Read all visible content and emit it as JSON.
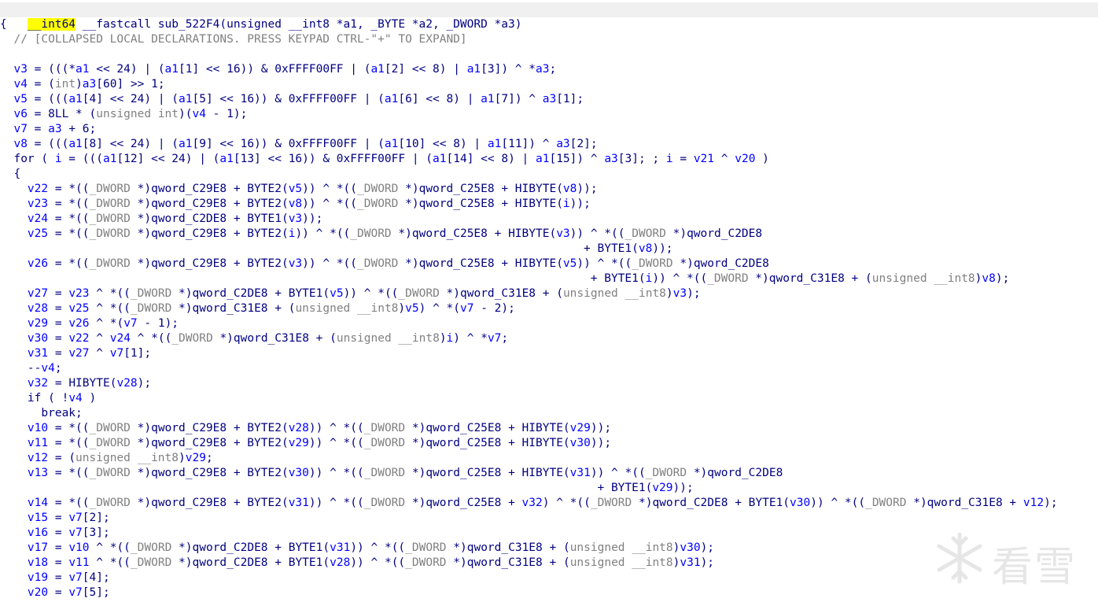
{
  "header": {
    "return_type": "__int64",
    "rest": " __fastcall sub_522F4(unsigned __int8 *a1, _BYTE *a2, _DWORD *a3)"
  },
  "watermark": {
    "text": "看雪",
    "icon": "snowflake-icon"
  },
  "lines": [
    [
      [
        "t",
        "{"
      ]
    ],
    [
      [
        "t",
        "  "
      ],
      [
        "c",
        "// [COLLAPSED LOCAL DECLARATIONS. PRESS KEYPAD CTRL-\"+\" TO EXPAND]"
      ]
    ],
    [],
    [
      [
        "t",
        "  "
      ],
      [
        "v",
        "v3"
      ],
      [
        "t",
        " = (((*"
      ],
      [
        "v",
        "a1"
      ],
      [
        "t",
        " << 24) | ("
      ],
      [
        "v",
        "a1"
      ],
      [
        "t",
        "[1] << 16)) & 0xFFFF00FF | ("
      ],
      [
        "v",
        "a1"
      ],
      [
        "t",
        "[2] << 8) | "
      ],
      [
        "v",
        "a1"
      ],
      [
        "t",
        "[3]) ^ *"
      ],
      [
        "v",
        "a3"
      ],
      [
        "t",
        ";"
      ]
    ],
    [
      [
        "t",
        "  "
      ],
      [
        "v",
        "v4"
      ],
      [
        "t",
        " = ("
      ],
      [
        "g",
        "int"
      ],
      [
        "t",
        ")"
      ],
      [
        "v",
        "a3"
      ],
      [
        "t",
        "[60] >> 1;"
      ]
    ],
    [
      [
        "t",
        "  "
      ],
      [
        "v",
        "v5"
      ],
      [
        "t",
        " = ((("
      ],
      [
        "v",
        "a1"
      ],
      [
        "t",
        "[4] << 24) | ("
      ],
      [
        "v",
        "a1"
      ],
      [
        "t",
        "[5] << 16)) & 0xFFFF00FF | ("
      ],
      [
        "v",
        "a1"
      ],
      [
        "t",
        "[6] << 8) | "
      ],
      [
        "v",
        "a1"
      ],
      [
        "t",
        "[7]) ^ "
      ],
      [
        "v",
        "a3"
      ],
      [
        "t",
        "[1];"
      ]
    ],
    [
      [
        "t",
        "  "
      ],
      [
        "v",
        "v6"
      ],
      [
        "t",
        " = 8LL * ("
      ],
      [
        "g",
        "unsigned int"
      ],
      [
        "t",
        ")("
      ],
      [
        "v",
        "v4"
      ],
      [
        "t",
        " - 1);"
      ]
    ],
    [
      [
        "t",
        "  "
      ],
      [
        "v",
        "v7"
      ],
      [
        "t",
        " = "
      ],
      [
        "v",
        "a3"
      ],
      [
        "t",
        " + 6;"
      ]
    ],
    [
      [
        "t",
        "  "
      ],
      [
        "v",
        "v8"
      ],
      [
        "t",
        " = ((("
      ],
      [
        "v",
        "a1"
      ],
      [
        "t",
        "[8] << 24) | ("
      ],
      [
        "v",
        "a1"
      ],
      [
        "t",
        "[9] << 16)) & 0xFFFF00FF | ("
      ],
      [
        "v",
        "a1"
      ],
      [
        "t",
        "[10] << 8) | "
      ],
      [
        "v",
        "a1"
      ],
      [
        "t",
        "[11]) ^ "
      ],
      [
        "v",
        "a3"
      ],
      [
        "t",
        "[2];"
      ]
    ],
    [
      [
        "t",
        "  for ( "
      ],
      [
        "v",
        "i"
      ],
      [
        "t",
        " = ((("
      ],
      [
        "v",
        "a1"
      ],
      [
        "t",
        "[12] << 24) | ("
      ],
      [
        "v",
        "a1"
      ],
      [
        "t",
        "[13] << 16)) & 0xFFFF00FF | ("
      ],
      [
        "v",
        "a1"
      ],
      [
        "t",
        "[14] << 8) | "
      ],
      [
        "v",
        "a1"
      ],
      [
        "t",
        "[15]) ^ "
      ],
      [
        "v",
        "a3"
      ],
      [
        "t",
        "[3]; ; "
      ],
      [
        "v",
        "i"
      ],
      [
        "t",
        " = "
      ],
      [
        "v",
        "v21"
      ],
      [
        "t",
        " ^ "
      ],
      [
        "v",
        "v20"
      ],
      [
        "t",
        " )"
      ]
    ],
    [
      [
        "t",
        "  {"
      ]
    ],
    [
      [
        "t",
        "    "
      ],
      [
        "v",
        "v22"
      ],
      [
        "t",
        " = *(("
      ],
      [
        "g",
        "_DWORD"
      ],
      [
        "t",
        " *)qword_C29E8 + BYTE2("
      ],
      [
        "v",
        "v5"
      ],
      [
        "t",
        ")) ^ *(("
      ],
      [
        "g",
        "_DWORD"
      ],
      [
        "t",
        " *)qword_C25E8 + HIBYTE("
      ],
      [
        "v",
        "v8"
      ],
      [
        "t",
        "));"
      ]
    ],
    [
      [
        "t",
        "    "
      ],
      [
        "v",
        "v23"
      ],
      [
        "t",
        " = *(("
      ],
      [
        "g",
        "_DWORD"
      ],
      [
        "t",
        " *)qword_C29E8 + BYTE2("
      ],
      [
        "v",
        "v8"
      ],
      [
        "t",
        ")) ^ *(("
      ],
      [
        "g",
        "_DWORD"
      ],
      [
        "t",
        " *)qword_C25E8 + HIBYTE("
      ],
      [
        "v",
        "i"
      ],
      [
        "t",
        "));"
      ]
    ],
    [
      [
        "t",
        "    "
      ],
      [
        "v",
        "v24"
      ],
      [
        "t",
        " = *(("
      ],
      [
        "g",
        "_DWORD"
      ],
      [
        "t",
        " *)qword_C2DE8 + BYTE1("
      ],
      [
        "v",
        "v3"
      ],
      [
        "t",
        "));"
      ]
    ],
    [
      [
        "t",
        "    "
      ],
      [
        "v",
        "v25"
      ],
      [
        "t",
        " = *(("
      ],
      [
        "g",
        "_DWORD"
      ],
      [
        "t",
        " *)qword_C29E8 + BYTE2("
      ],
      [
        "v",
        "i"
      ],
      [
        "t",
        ")) ^ *(("
      ],
      [
        "g",
        "_DWORD"
      ],
      [
        "t",
        " *)qword_C25E8 + HIBYTE("
      ],
      [
        "v",
        "v3"
      ],
      [
        "t",
        ")) ^ *(("
      ],
      [
        "g",
        "_DWORD"
      ],
      [
        "t",
        " *)qword_C2DE8"
      ]
    ],
    [
      [
        "t",
        "                                                                                     + BYTE1("
      ],
      [
        "v",
        "v8"
      ],
      [
        "t",
        "));"
      ]
    ],
    [
      [
        "t",
        "    "
      ],
      [
        "v",
        "v26"
      ],
      [
        "t",
        " = *(("
      ],
      [
        "g",
        "_DWORD"
      ],
      [
        "t",
        " *)qword_C29E8 + BYTE2("
      ],
      [
        "v",
        "v3"
      ],
      [
        "t",
        ")) ^ *(("
      ],
      [
        "g",
        "_DWORD"
      ],
      [
        "t",
        " *)qword_C25E8 + HIBYTE("
      ],
      [
        "v",
        "v5"
      ],
      [
        "t",
        ")) ^ *(("
      ],
      [
        "g",
        "_DWORD"
      ],
      [
        "t",
        " *)qword_C2DE8"
      ]
    ],
    [
      [
        "t",
        "                                                                                      + BYTE1("
      ],
      [
        "v",
        "i"
      ],
      [
        "t",
        ")) ^ *(("
      ],
      [
        "g",
        "_DWORD"
      ],
      [
        "t",
        " *)qword_C31E8 + ("
      ],
      [
        "g",
        "unsigned __int8"
      ],
      [
        "t",
        ")"
      ],
      [
        "v",
        "v8"
      ],
      [
        "t",
        ");"
      ]
    ],
    [
      [
        "t",
        "    "
      ],
      [
        "v",
        "v27"
      ],
      [
        "t",
        " = "
      ],
      [
        "v",
        "v23"
      ],
      [
        "t",
        " ^ *(("
      ],
      [
        "g",
        "_DWORD"
      ],
      [
        "t",
        " *)qword_C2DE8 + BYTE1("
      ],
      [
        "v",
        "v5"
      ],
      [
        "t",
        ")) ^ *(("
      ],
      [
        "g",
        "_DWORD"
      ],
      [
        "t",
        " *)qword_C31E8 + ("
      ],
      [
        "g",
        "unsigned __int8"
      ],
      [
        "t",
        ")"
      ],
      [
        "v",
        "v3"
      ],
      [
        "t",
        ");"
      ]
    ],
    [
      [
        "t",
        "    "
      ],
      [
        "v",
        "v28"
      ],
      [
        "t",
        " = "
      ],
      [
        "v",
        "v25"
      ],
      [
        "t",
        " ^ *(("
      ],
      [
        "g",
        "_DWORD"
      ],
      [
        "t",
        " *)qword_C31E8 + ("
      ],
      [
        "g",
        "unsigned __int8"
      ],
      [
        "t",
        ")"
      ],
      [
        "v",
        "v5"
      ],
      [
        "t",
        ") ^ *("
      ],
      [
        "v",
        "v7"
      ],
      [
        "t",
        " - 2);"
      ]
    ],
    [
      [
        "t",
        "    "
      ],
      [
        "v",
        "v29"
      ],
      [
        "t",
        " = "
      ],
      [
        "v",
        "v26"
      ],
      [
        "t",
        " ^ *("
      ],
      [
        "v",
        "v7"
      ],
      [
        "t",
        " - 1);"
      ]
    ],
    [
      [
        "t",
        "    "
      ],
      [
        "v",
        "v30"
      ],
      [
        "t",
        " = "
      ],
      [
        "v",
        "v22"
      ],
      [
        "t",
        " ^ "
      ],
      [
        "v",
        "v24"
      ],
      [
        "t",
        " ^ *(("
      ],
      [
        "g",
        "_DWORD"
      ],
      [
        "t",
        " *)qword_C31E8 + ("
      ],
      [
        "g",
        "unsigned __int8"
      ],
      [
        "t",
        ")"
      ],
      [
        "v",
        "i"
      ],
      [
        "t",
        ") ^ *"
      ],
      [
        "v",
        "v7"
      ],
      [
        "t",
        ";"
      ]
    ],
    [
      [
        "t",
        "    "
      ],
      [
        "v",
        "v31"
      ],
      [
        "t",
        " = "
      ],
      [
        "v",
        "v27"
      ],
      [
        "t",
        " ^ "
      ],
      [
        "v",
        "v7"
      ],
      [
        "t",
        "[1];"
      ]
    ],
    [
      [
        "t",
        "    --"
      ],
      [
        "v",
        "v4"
      ],
      [
        "t",
        ";"
      ]
    ],
    [
      [
        "t",
        "    "
      ],
      [
        "v",
        "v32"
      ],
      [
        "t",
        " = HIBYTE("
      ],
      [
        "v",
        "v28"
      ],
      [
        "t",
        ");"
      ]
    ],
    [
      [
        "t",
        "    if ( !"
      ],
      [
        "v",
        "v4"
      ],
      [
        "t",
        " )"
      ]
    ],
    [
      [
        "t",
        "      break;"
      ]
    ],
    [
      [
        "t",
        "    "
      ],
      [
        "v",
        "v10"
      ],
      [
        "t",
        " = *(("
      ],
      [
        "g",
        "_DWORD"
      ],
      [
        "t",
        " *)qword_C29E8 + BYTE2("
      ],
      [
        "v",
        "v28"
      ],
      [
        "t",
        ")) ^ *(("
      ],
      [
        "g",
        "_DWORD"
      ],
      [
        "t",
        " *)qword_C25E8 + HIBYTE("
      ],
      [
        "v",
        "v29"
      ],
      [
        "t",
        "));"
      ]
    ],
    [
      [
        "t",
        "    "
      ],
      [
        "v",
        "v11"
      ],
      [
        "t",
        " = *(("
      ],
      [
        "g",
        "_DWORD"
      ],
      [
        "t",
        " *)qword_C29E8 + BYTE2("
      ],
      [
        "v",
        "v29"
      ],
      [
        "t",
        ")) ^ *(("
      ],
      [
        "g",
        "_DWORD"
      ],
      [
        "t",
        " *)qword_C25E8 + HIBYTE("
      ],
      [
        "v",
        "v30"
      ],
      [
        "t",
        "));"
      ]
    ],
    [
      [
        "t",
        "    "
      ],
      [
        "v",
        "v12"
      ],
      [
        "t",
        " = ("
      ],
      [
        "g",
        "unsigned __int8"
      ],
      [
        "t",
        ")"
      ],
      [
        "v",
        "v29"
      ],
      [
        "t",
        ";"
      ]
    ],
    [
      [
        "t",
        "    "
      ],
      [
        "v",
        "v13"
      ],
      [
        "t",
        " = *(("
      ],
      [
        "g",
        "_DWORD"
      ],
      [
        "t",
        " *)qword_C29E8 + BYTE2("
      ],
      [
        "v",
        "v30"
      ],
      [
        "t",
        ")) ^ *(("
      ],
      [
        "g",
        "_DWORD"
      ],
      [
        "t",
        " *)qword_C25E8 + HIBYTE("
      ],
      [
        "v",
        "v31"
      ],
      [
        "t",
        ")) ^ *(("
      ],
      [
        "g",
        "_DWORD"
      ],
      [
        "t",
        " *)qword_C2DE8"
      ]
    ],
    [
      [
        "t",
        "                                                                                       + BYTE1("
      ],
      [
        "v",
        "v29"
      ],
      [
        "t",
        "));"
      ]
    ],
    [
      [
        "t",
        "    "
      ],
      [
        "v",
        "v14"
      ],
      [
        "t",
        " = *(("
      ],
      [
        "g",
        "_DWORD"
      ],
      [
        "t",
        " *)qword_C29E8 + BYTE2("
      ],
      [
        "v",
        "v31"
      ],
      [
        "t",
        ")) ^ *(("
      ],
      [
        "g",
        "_DWORD"
      ],
      [
        "t",
        " *)qword_C25E8 + "
      ],
      [
        "v",
        "v32"
      ],
      [
        "t",
        ") ^ *(("
      ],
      [
        "g",
        "_DWORD"
      ],
      [
        "t",
        " *)qword_C2DE8 + BYTE1("
      ],
      [
        "v",
        "v30"
      ],
      [
        "t",
        ")) ^ *(("
      ],
      [
        "g",
        "_DWORD"
      ],
      [
        "t",
        " *)qword_C31E8 + "
      ],
      [
        "v",
        "v12"
      ],
      [
        "t",
        ");"
      ]
    ],
    [
      [
        "t",
        "    "
      ],
      [
        "v",
        "v15"
      ],
      [
        "t",
        " = "
      ],
      [
        "v",
        "v7"
      ],
      [
        "t",
        "[2];"
      ]
    ],
    [
      [
        "t",
        "    "
      ],
      [
        "v",
        "v16"
      ],
      [
        "t",
        " = "
      ],
      [
        "v",
        "v7"
      ],
      [
        "t",
        "[3];"
      ]
    ],
    [
      [
        "t",
        "    "
      ],
      [
        "v",
        "v17"
      ],
      [
        "t",
        " = "
      ],
      [
        "v",
        "v10"
      ],
      [
        "t",
        " ^ *(("
      ],
      [
        "g",
        "_DWORD"
      ],
      [
        "t",
        " *)qword_C2DE8 + BYTE1("
      ],
      [
        "v",
        "v31"
      ],
      [
        "t",
        ")) ^ *(("
      ],
      [
        "g",
        "_DWORD"
      ],
      [
        "t",
        " *)qword_C31E8 + ("
      ],
      [
        "g",
        "unsigned __int8"
      ],
      [
        "t",
        ")"
      ],
      [
        "v",
        "v30"
      ],
      [
        "t",
        ");"
      ]
    ],
    [
      [
        "t",
        "    "
      ],
      [
        "v",
        "v18"
      ],
      [
        "t",
        " = "
      ],
      [
        "v",
        "v11"
      ],
      [
        "t",
        " ^ *(("
      ],
      [
        "g",
        "_DWORD"
      ],
      [
        "t",
        " *)qword_C2DE8 + BYTE1("
      ],
      [
        "v",
        "v28"
      ],
      [
        "t",
        ")) ^ *(("
      ],
      [
        "g",
        "_DWORD"
      ],
      [
        "t",
        " *)qword_C31E8 + ("
      ],
      [
        "g",
        "unsigned __int8"
      ],
      [
        "t",
        ")"
      ],
      [
        "v",
        "v31"
      ],
      [
        "t",
        ");"
      ]
    ],
    [
      [
        "t",
        "    "
      ],
      [
        "v",
        "v19"
      ],
      [
        "t",
        " = "
      ],
      [
        "v",
        "v7"
      ],
      [
        "t",
        "[4];"
      ]
    ],
    [
      [
        "t",
        "    "
      ],
      [
        "v",
        "v20"
      ],
      [
        "t",
        " = "
      ],
      [
        "v",
        "v7"
      ],
      [
        "t",
        "[5];"
      ]
    ]
  ]
}
